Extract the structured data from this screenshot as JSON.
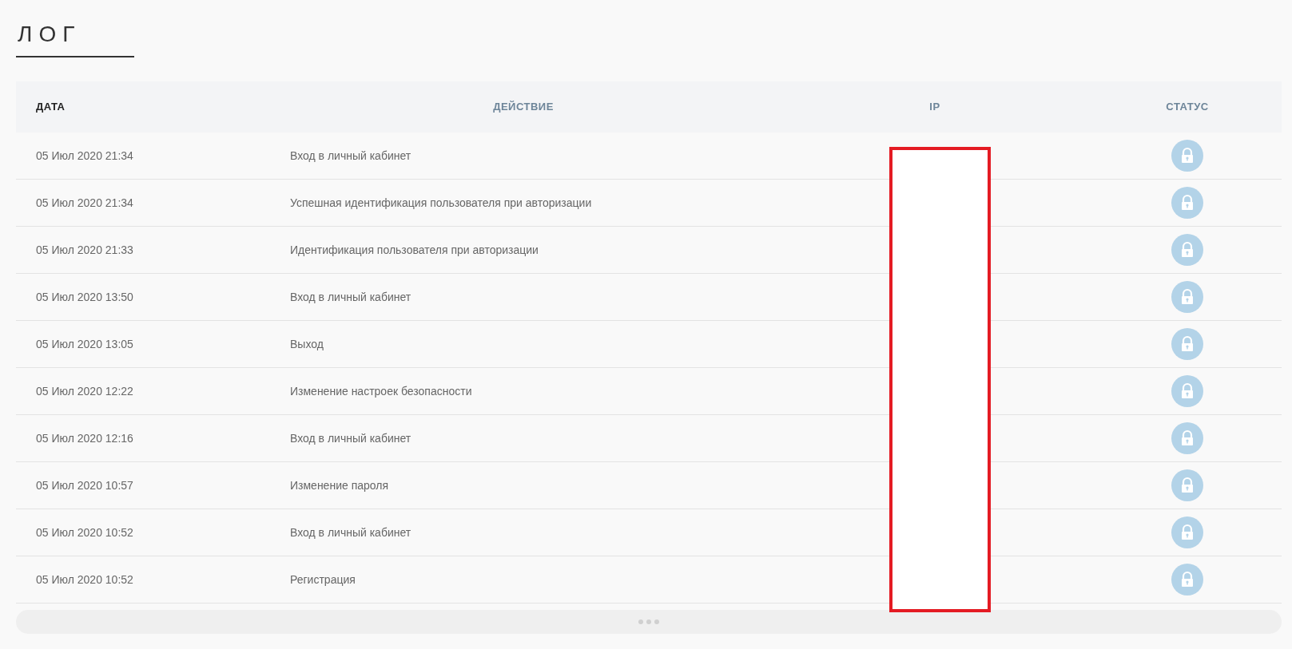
{
  "title": "ЛОГ",
  "table": {
    "columns": [
      {
        "label": "ДАТА",
        "active": true
      },
      {
        "label": "ДЕЙСТВИЕ",
        "active": false
      },
      {
        "label": "IP",
        "active": false
      },
      {
        "label": "СТАТУС",
        "active": false
      }
    ],
    "rows": [
      {
        "date": "05 Июл 2020 21:34",
        "action": "Вход в личный кабинет"
      },
      {
        "date": "05 Июл 2020 21:34",
        "action": "Успешная идентификация пользователя при авторизации"
      },
      {
        "date": "05 Июл 2020 21:33",
        "action": "Идентификация пользователя при авторизации"
      },
      {
        "date": "05 Июл 2020 13:50",
        "action": "Вход в личный кабинет"
      },
      {
        "date": "05 Июл 2020 13:05",
        "action": "Выход"
      },
      {
        "date": "05 Июл 2020 12:22",
        "action": "Изменение настроек безопасности"
      },
      {
        "date": "05 Июл 2020 12:16",
        "action": "Вход в личный кабинет"
      },
      {
        "date": "05 Июл 2020 10:57",
        "action": "Изменение пароля"
      },
      {
        "date": "05 Июл 2020 10:52",
        "action": "Вход в личный кабинет"
      },
      {
        "date": "05 Июл 2020 10:52",
        "action": "Регистрация"
      }
    ]
  }
}
